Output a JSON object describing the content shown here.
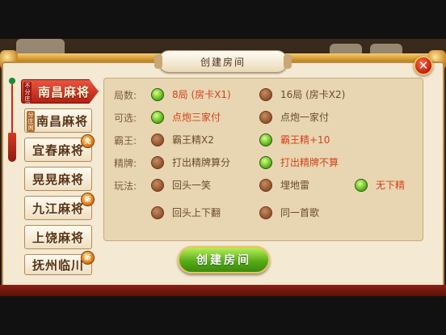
{
  "dialog": {
    "title": "创建房间",
    "close_symbol": "✕"
  },
  "sidebar": {
    "items": [
      {
        "tag": "不分庄闲",
        "label": "南昌麻将",
        "active": true,
        "badge": ""
      },
      {
        "tag": "分庄闲",
        "label": "南昌麻将",
        "active": false,
        "badge": ""
      },
      {
        "tag": "",
        "label": "宜春麻将",
        "active": false,
        "badge": "免"
      },
      {
        "tag": "",
        "label": "晃晃麻将",
        "active": false,
        "badge": ""
      },
      {
        "tag": "",
        "label": "九江麻将",
        "active": false,
        "badge": "新"
      },
      {
        "tag": "",
        "label": "上饶麻将",
        "active": false,
        "badge": ""
      },
      {
        "tag": "",
        "label": "抚州临川",
        "active": false,
        "badge": "新"
      }
    ]
  },
  "options": {
    "rounds": {
      "label": "局数:",
      "choices": [
        {
          "text": "8局 (房卡X1)",
          "selected": true
        },
        {
          "text": "16局 (房卡X2)",
          "selected": false
        }
      ]
    },
    "optional": {
      "label": "可选:",
      "choices": [
        {
          "text": "点炮三家付",
          "selected": true
        },
        {
          "text": "点炮一家付",
          "selected": false
        }
      ]
    },
    "bawang": {
      "label": "霸王:",
      "choices": [
        {
          "text": "霸王精X2",
          "selected": false
        },
        {
          "text": "霸王精+10",
          "selected": true
        }
      ]
    },
    "jingpai": {
      "label": "精牌:",
      "choices": [
        {
          "text": "打出精牌算分",
          "selected": false
        },
        {
          "text": "打出精牌不算",
          "selected": true
        }
      ]
    },
    "play": {
      "label": "玩法:",
      "choices": [
        {
          "text": "回头一笑",
          "selected": false
        },
        {
          "text": "埋地雷",
          "selected": false
        },
        {
          "text": "无下精",
          "selected": true
        },
        {
          "text": "回头上下翻",
          "selected": false
        },
        {
          "text": "同一首歌",
          "selected": false
        }
      ]
    }
  },
  "footer": {
    "create_label": "创建房间"
  },
  "colors": {
    "accent_red": "#d4421b",
    "selected_green": "#62b91f",
    "panel_bg": "#f4e9d3"
  }
}
